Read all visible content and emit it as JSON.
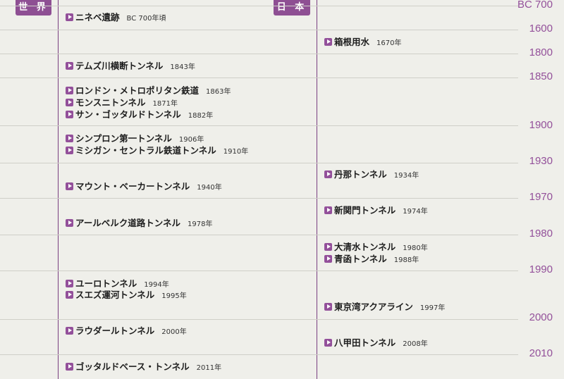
{
  "headers": {
    "world": "世 界",
    "japan": "日 本"
  },
  "year_labels": [
    "BC 700",
    "1600",
    "1800",
    "1850",
    "1900",
    "1930",
    "1970",
    "1980",
    "1990",
    "2000",
    "2010"
  ],
  "world_events": [
    {
      "name": "ニネベ遺跡",
      "year": "BC 700年頃"
    },
    {
      "name": "テムズ川横断トンネル",
      "year": "1843年"
    },
    {
      "name": "ロンドン・メトロポリタン鉄道",
      "year": "1863年"
    },
    {
      "name": "モンスニトンネル",
      "year": "1871年"
    },
    {
      "name": "サン・ゴッタルドトンネル",
      "year": "1882年"
    },
    {
      "name": "シンプロン第一トンネル",
      "year": "1906年"
    },
    {
      "name": "ミシガン・セントラル鉄道トンネル",
      "year": "1910年"
    },
    {
      "name": "マウント・ベーカートンネル",
      "year": "1940年"
    },
    {
      "name": "アールベルク道路トンネル",
      "year": "1978年"
    },
    {
      "name": "ユーロトンネル",
      "year": "1994年"
    },
    {
      "name": "スエズ運河トンネル",
      "year": "1995年"
    },
    {
      "name": "ラウダールトンネル",
      "year": "2000年"
    },
    {
      "name": "ゴッタルドベース・トンネル",
      "year": "2011年"
    }
  ],
  "japan_events": [
    {
      "name": "箱根用水",
      "year": "1670年"
    },
    {
      "name": "丹那トンネル",
      "year": "1934年"
    },
    {
      "name": "新関門トンネル",
      "year": "1974年"
    },
    {
      "name": "大清水トンネル",
      "year": "1980年"
    },
    {
      "name": "青函トンネル",
      "year": "1988年"
    },
    {
      "name": "東京湾アクアライン",
      "year": "1997年"
    },
    {
      "name": "八甲田トンネル",
      "year": "2008年"
    }
  ]
}
